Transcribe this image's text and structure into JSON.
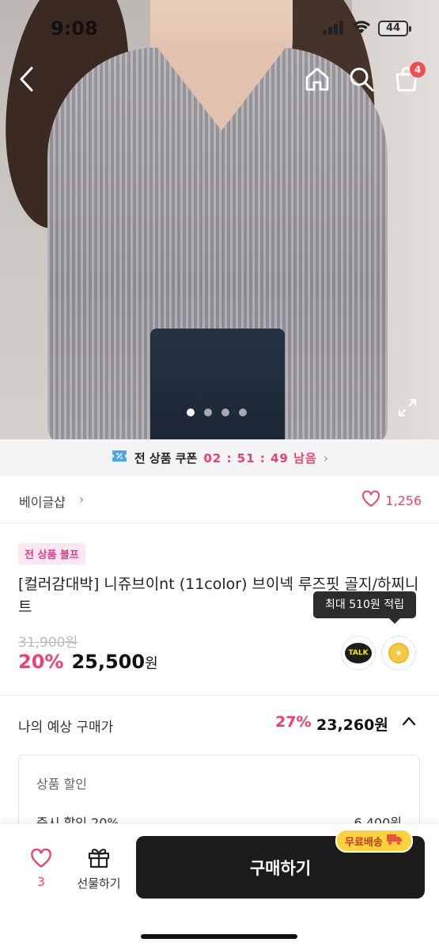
{
  "status_bar": {
    "time": "9:08",
    "battery": "44"
  },
  "header": {
    "cart_count": "4"
  },
  "hero": {
    "slide_count": 4,
    "active_slide": 1
  },
  "coupon": {
    "title": "전 상품 쿠폰",
    "timer": "02 : 51 : 49 남음",
    "chevron": "›"
  },
  "shop": {
    "name": "베이글샵",
    "chevron": "›",
    "likes": "1,256"
  },
  "product": {
    "tag": "전 상품 블프",
    "title": "[컬러감대박] 니쥬브이nt (11color) 브이넥 루즈핏 골지/하찌니트",
    "tooltip": "최대 510원 적립",
    "original_price": "31,900원",
    "discount_percent": "20%",
    "price": "25,500",
    "price_unit": "원",
    "talk_label": "TALK"
  },
  "estimate": {
    "label": "나의 예상 구매가",
    "percent": "27%",
    "price": "23,260원"
  },
  "discount_box": {
    "heading": "상품 할인",
    "line1_label": "즉시 할인 20%",
    "line1_value": "6,400원"
  },
  "bottom_bar": {
    "wish_count": "3",
    "gift_label": "선물하기",
    "buy_label": "구매하기",
    "free_shipping": "무료배송"
  },
  "colors": {
    "accent_pink": "#f0416c",
    "buy_button": "#1c1c1c",
    "free_ship": "#ffd23c"
  }
}
